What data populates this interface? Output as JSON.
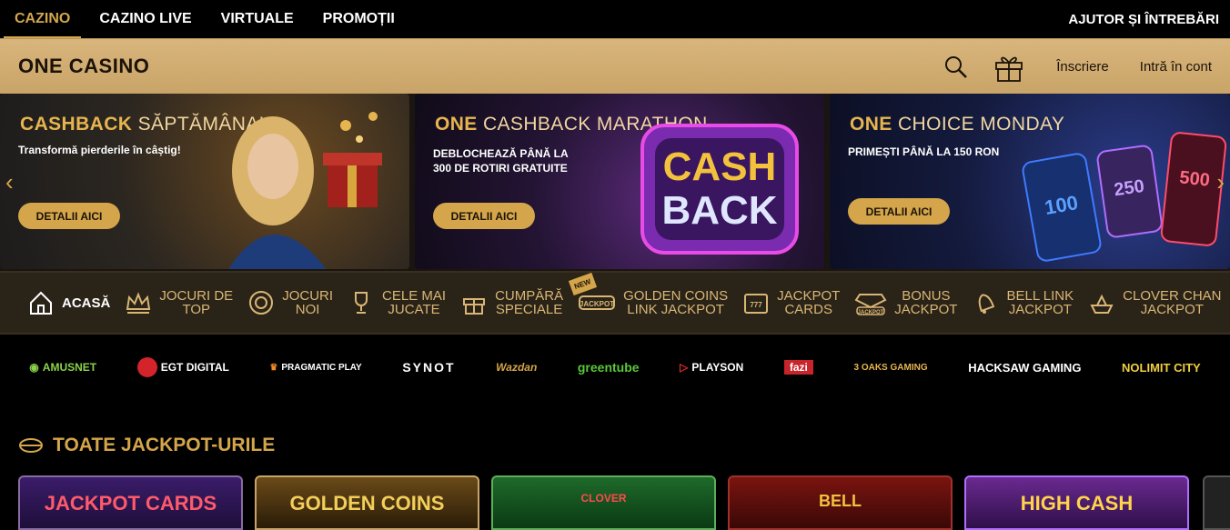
{
  "topnav": {
    "items": [
      "CAZINO",
      "CAZINO LIVE",
      "VIRTUALE",
      "PROMOȚII"
    ],
    "help": "AJUTOR ȘI ÎNTREBĂRI"
  },
  "header": {
    "logo": "ONE CASINO",
    "signup": "Înscriere",
    "login": "Intră în cont"
  },
  "banners": [
    {
      "title_strong": "CASHBACK",
      "title_rest": " SĂPTĂMÂNAL",
      "sub1": "Transformă pierderile în câștig!",
      "sub2": "",
      "button": "DETALII AICI"
    },
    {
      "title_strong": "ONE",
      "title_rest": " CASHBACK MARATHON",
      "sub1": "DEBLOCHEAZĂ PÂNĂ LA",
      "sub2": "300 DE ROTIRI GRATUITE",
      "art": "CASH BACK",
      "button": "DETALII AICI"
    },
    {
      "title_strong": "ONE",
      "title_rest": " CHOICE MONDAY",
      "sub1": "PRIMEȘTI PÂNĂ LA 150 RON",
      "sub2": "",
      "art": [
        "100 BONUS 30",
        "250 BONUS 75",
        "500 BONUS 150"
      ],
      "button": "DETALII AICI"
    }
  ],
  "categories": [
    {
      "l1": "ACASĂ",
      "l2": "",
      "icon": "home-icon"
    },
    {
      "l1": "JOCURI DE",
      "l2": "TOP",
      "icon": "crown-icon"
    },
    {
      "l1": "JOCURI",
      "l2": "NOI",
      "icon": "chip-icon"
    },
    {
      "l1": "CELE MAI",
      "l2": "JUCATE",
      "icon": "trophy-icon"
    },
    {
      "l1": "CUMPĂRĂ",
      "l2": "SPECIALE",
      "icon": "gift-icon"
    },
    {
      "l1": "GOLDEN COINS",
      "l2": "LINK JACKPOT",
      "icon": "jackpot-icon",
      "badge": "NEW",
      "badge_icon_text": "JACKPOT"
    },
    {
      "l1": "JACKPOT",
      "l2": "CARDS",
      "icon": "slot-777-icon",
      "badge_icon_text": "777"
    },
    {
      "l1": "BONUS",
      "l2": "JACKPOT",
      "icon": "diamond-jackpot-icon",
      "badge_icon_text": "JACKPOT"
    },
    {
      "l1": "BELL LINK",
      "l2": "JACKPOT",
      "icon": "bell-icon"
    },
    {
      "l1": "CLOVER CHAN",
      "l2": "JACKPOT",
      "icon": "clover-pot-icon"
    }
  ],
  "providers": [
    "AMUSNET",
    "EGT DIGITAL",
    "PRAGMATIC PLAY",
    "SYNOT",
    "Wazdan",
    "greentube",
    "PLAYSON",
    "fazi",
    "3 OAKS GAMING",
    "HACKSAW GAMING",
    "NOLIMIT CITY"
  ],
  "section": {
    "title": "TOATE JACKPOT-URILE"
  },
  "games": [
    "JACKPOT CARDS",
    "GOLDEN COINS",
    "CLOVER",
    "BELL",
    "HIGH CASH"
  ]
}
